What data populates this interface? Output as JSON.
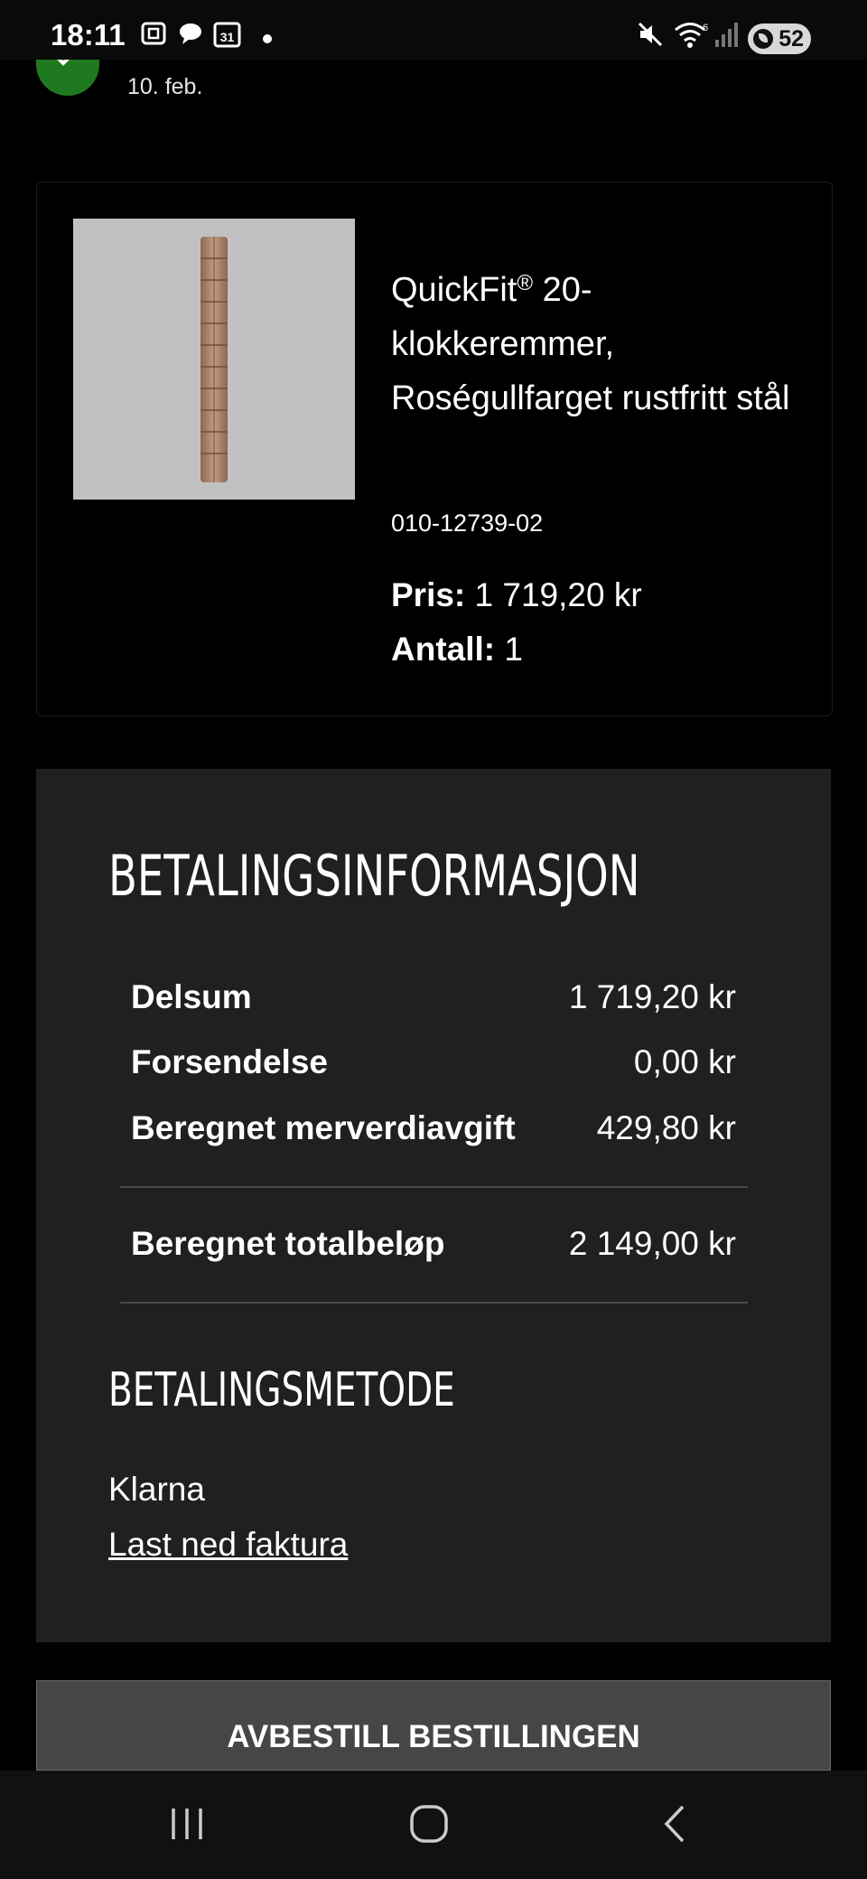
{
  "status_bar": {
    "time": "18:11",
    "battery": "52",
    "icons": [
      "screenshot-icon",
      "chat-bubble-icon",
      "calendar-icon",
      "notification-dot",
      "mute-icon",
      "wifi-icon",
      "signal-icon",
      "battery-icon"
    ],
    "calendar_day": "31"
  },
  "order_step": {
    "date": "10. feb."
  },
  "product": {
    "name": "QuickFit",
    "name_reg": "®",
    "name_rest": " 20-klokkeremmer, Roségullfarget rustfritt stål",
    "sku": "010-12739-02",
    "price_label": "Pris:",
    "price_value": "1 719,20 kr",
    "qty_label": "Antall:",
    "qty_value": "1"
  },
  "payment_info": {
    "heading": "BETALINGSINFORMASJON",
    "rows": [
      {
        "label": "Delsum",
        "value": "1 719,20 kr"
      },
      {
        "label": "Forsendelse",
        "value": "0,00 kr"
      },
      {
        "label": "Beregnet merverdiavgift",
        "value": "429,80 kr"
      }
    ],
    "total": {
      "label": "Beregnet totalbeløp",
      "value": "2 149,00 kr"
    }
  },
  "payment_method": {
    "heading": "BETALINGSMETODE",
    "method": "Klarna",
    "invoice_link": "Last ned faktura"
  },
  "actions": {
    "cancel_label": "AVBESTILL BESTILLINGEN"
  },
  "colors": {
    "background": "#000000",
    "panel": "#202020",
    "button": "#464646",
    "success_green": "#1f7a1f"
  }
}
